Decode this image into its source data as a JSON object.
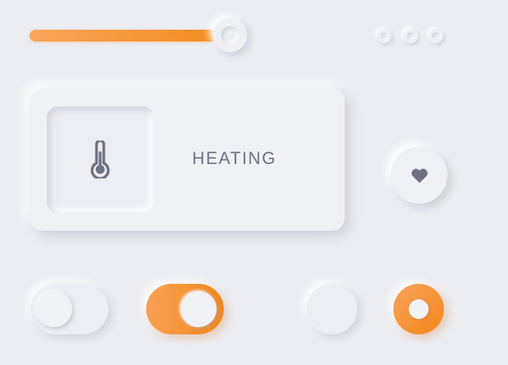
{
  "slider": {
    "value_percent": 100,
    "fill_color": "#f48a1c"
  },
  "dots": {
    "count": 3
  },
  "card": {
    "icon": "thermometer-icon",
    "label": "HEATING"
  },
  "favorite": {
    "icon": "heart-icon"
  },
  "toggles": [
    {
      "state": "off"
    },
    {
      "state": "on",
      "color": "#f4861a"
    }
  ],
  "radios": [
    {
      "selected": false
    },
    {
      "selected": true,
      "color": "#f4851a"
    }
  ],
  "colors": {
    "background": "#ebedf2",
    "accent": "#f48a1c",
    "icon": "#6b7180"
  }
}
